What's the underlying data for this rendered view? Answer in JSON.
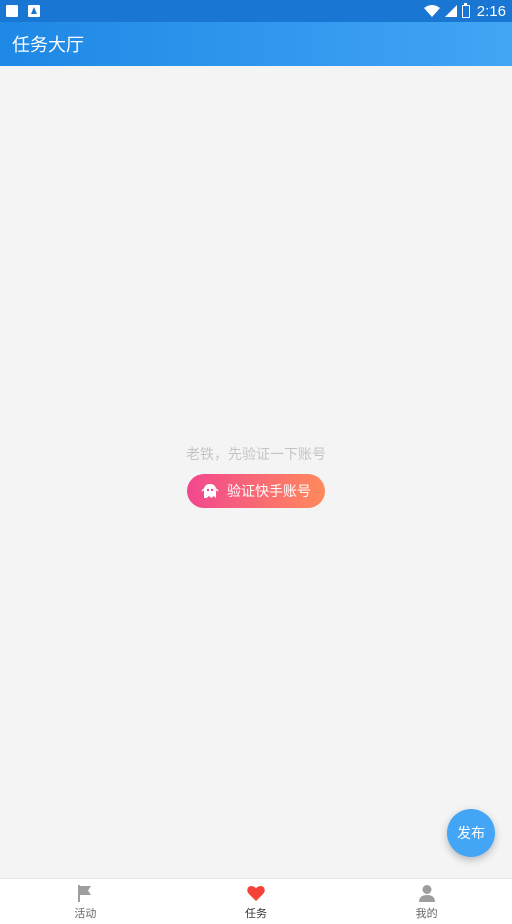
{
  "status_bar": {
    "time": "2:16"
  },
  "app_bar": {
    "title": "任务大厅"
  },
  "empty_state": {
    "hint": "老铁，先验证一下账号",
    "verify_button_label": "验证快手账号"
  },
  "fab": {
    "label": "发布"
  },
  "bottom_nav": {
    "items": [
      {
        "label": "活动",
        "icon": "flag-icon"
      },
      {
        "label": "任务",
        "icon": "heart-icon",
        "active": true
      },
      {
        "label": "我的",
        "icon": "person-icon"
      }
    ]
  },
  "colors": {
    "app_bar_start": "#1e88e5",
    "app_bar_end": "#42a5f5",
    "button_start": "#f2478e",
    "button_end": "#ff8a5c",
    "fab": "#42a5f5",
    "active_heart": "#f44336"
  }
}
